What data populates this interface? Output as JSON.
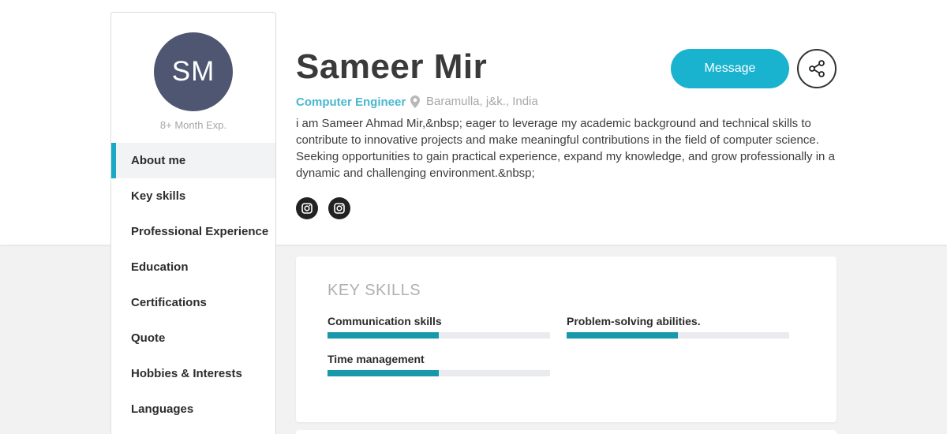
{
  "profile": {
    "initials": "SM",
    "experience": "8+ Month Exp.",
    "name": "Sameer Mir",
    "role": "Computer Engineer",
    "location": "Baramulla, j&k., India",
    "bio": "i am Sameer Ahmad Mir,&nbsp; eager to leverage my academic background and technical skills to contribute to innovative projects and make meaningful contributions in the field of computer science. Seeking opportunities to gain practical experience, expand my knowledge, and grow professionally in a dynamic and challenging environment.&nbsp;"
  },
  "nav": {
    "items": [
      {
        "label": "About me",
        "active": true
      },
      {
        "label": "Key skills",
        "active": false
      },
      {
        "label": "Professional Experience",
        "active": false
      },
      {
        "label": "Education",
        "active": false
      },
      {
        "label": "Certifications",
        "active": false
      },
      {
        "label": "Quote",
        "active": false
      },
      {
        "label": "Hobbies & Interests",
        "active": false
      },
      {
        "label": "Languages",
        "active": false
      }
    ]
  },
  "actions": {
    "message_label": "Message",
    "share_icon": "share-icon"
  },
  "social": {
    "icons": [
      "instagram-icon",
      "instagram-icon"
    ]
  },
  "key_skills": {
    "title": "KEY SKILLS",
    "skills": [
      {
        "name": "Communication skills",
        "level_percent": 50
      },
      {
        "name": "Problem-solving abilities.",
        "level_percent": 50
      },
      {
        "name": "Time management",
        "level_percent": 50
      }
    ]
  },
  "colors": {
    "accent": "#19b3cf",
    "avatar_bg": "#4f5672",
    "role_text": "#48b8d0",
    "skill_bar": "#1898ab"
  }
}
